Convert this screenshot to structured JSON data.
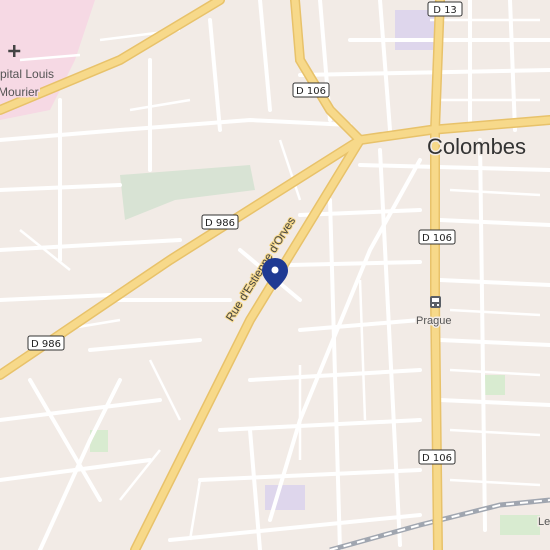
{
  "map": {
    "place_label": "Colombes",
    "hospital_label_line1": "pital Louis",
    "hospital_label_line2": "Mourier",
    "street_label": "Rue d'Estienne d'Orves",
    "station_label": "Prague",
    "edge_label_right": "Le",
    "road_shields": {
      "d13": "D 13",
      "d106_top": "D 106",
      "d106_mid": "D 106",
      "d106_bottom": "D 106",
      "d986_upper": "D 986",
      "d986_left": "D 986"
    },
    "icons": {
      "marker": "map-pin-icon",
      "hospital": "hospital-cross-icon",
      "station": "bus-station-icon"
    },
    "colors": {
      "background": "#f2ebe6",
      "major_road": "#f7d98a",
      "major_road_casing": "#e8c26a",
      "minor_road": "#ffffff",
      "hospital_area": "#f6d9e4",
      "park": "#d8ebd0",
      "marker": "#1f3a93",
      "rail": "#a0a6b0"
    }
  }
}
